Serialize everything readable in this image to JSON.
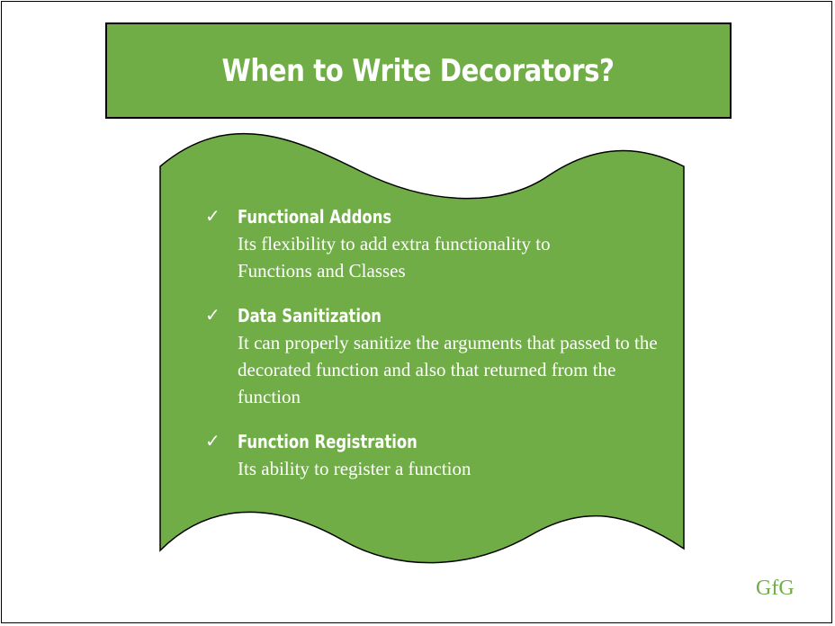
{
  "title": "When to Write Decorators?",
  "items": [
    {
      "icon": "check-icon",
      "heading": "Functional Addons",
      "description": "Its flexibility to add extra functionality to Functions and Classes"
    },
    {
      "icon": "check-icon",
      "heading": "Data Sanitization",
      "description": "It can properly sanitize the arguments that passed to the decorated function and also that returned from the function"
    },
    {
      "icon": "check-icon",
      "heading": "Function Registration",
      "description": "Its ability to register a function"
    }
  ],
  "logo": "GfG",
  "colors": {
    "accent": "#70ad47",
    "text": "#ffffff",
    "border": "#000000"
  }
}
